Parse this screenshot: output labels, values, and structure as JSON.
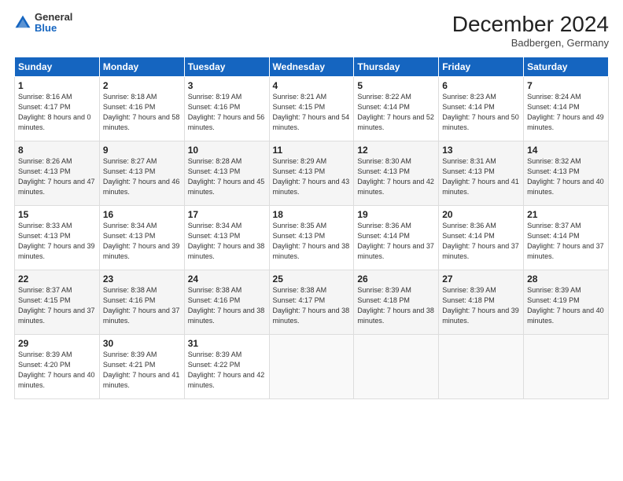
{
  "logo": {
    "general": "General",
    "blue": "Blue"
  },
  "title": "December 2024",
  "location": "Badbergen, Germany",
  "days_header": [
    "Sunday",
    "Monday",
    "Tuesday",
    "Wednesday",
    "Thursday",
    "Friday",
    "Saturday"
  ],
  "weeks": [
    [
      {
        "num": "1",
        "sunrise": "8:16 AM",
        "sunset": "4:17 PM",
        "daylight": "8 hours and 0 minutes."
      },
      {
        "num": "2",
        "sunrise": "8:18 AM",
        "sunset": "4:16 PM",
        "daylight": "7 hours and 58 minutes."
      },
      {
        "num": "3",
        "sunrise": "8:19 AM",
        "sunset": "4:16 PM",
        "daylight": "7 hours and 56 minutes."
      },
      {
        "num": "4",
        "sunrise": "8:21 AM",
        "sunset": "4:15 PM",
        "daylight": "7 hours and 54 minutes."
      },
      {
        "num": "5",
        "sunrise": "8:22 AM",
        "sunset": "4:14 PM",
        "daylight": "7 hours and 52 minutes."
      },
      {
        "num": "6",
        "sunrise": "8:23 AM",
        "sunset": "4:14 PM",
        "daylight": "7 hours and 50 minutes."
      },
      {
        "num": "7",
        "sunrise": "8:24 AM",
        "sunset": "4:14 PM",
        "daylight": "7 hours and 49 minutes."
      }
    ],
    [
      {
        "num": "8",
        "sunrise": "8:26 AM",
        "sunset": "4:13 PM",
        "daylight": "7 hours and 47 minutes."
      },
      {
        "num": "9",
        "sunrise": "8:27 AM",
        "sunset": "4:13 PM",
        "daylight": "7 hours and 46 minutes."
      },
      {
        "num": "10",
        "sunrise": "8:28 AM",
        "sunset": "4:13 PM",
        "daylight": "7 hours and 45 minutes."
      },
      {
        "num": "11",
        "sunrise": "8:29 AM",
        "sunset": "4:13 PM",
        "daylight": "7 hours and 43 minutes."
      },
      {
        "num": "12",
        "sunrise": "8:30 AM",
        "sunset": "4:13 PM",
        "daylight": "7 hours and 42 minutes."
      },
      {
        "num": "13",
        "sunrise": "8:31 AM",
        "sunset": "4:13 PM",
        "daylight": "7 hours and 41 minutes."
      },
      {
        "num": "14",
        "sunrise": "8:32 AM",
        "sunset": "4:13 PM",
        "daylight": "7 hours and 40 minutes."
      }
    ],
    [
      {
        "num": "15",
        "sunrise": "8:33 AM",
        "sunset": "4:13 PM",
        "daylight": "7 hours and 39 minutes."
      },
      {
        "num": "16",
        "sunrise": "8:34 AM",
        "sunset": "4:13 PM",
        "daylight": "7 hours and 39 minutes."
      },
      {
        "num": "17",
        "sunrise": "8:34 AM",
        "sunset": "4:13 PM",
        "daylight": "7 hours and 38 minutes."
      },
      {
        "num": "18",
        "sunrise": "8:35 AM",
        "sunset": "4:13 PM",
        "daylight": "7 hours and 38 minutes."
      },
      {
        "num": "19",
        "sunrise": "8:36 AM",
        "sunset": "4:14 PM",
        "daylight": "7 hours and 37 minutes."
      },
      {
        "num": "20",
        "sunrise": "8:36 AM",
        "sunset": "4:14 PM",
        "daylight": "7 hours and 37 minutes."
      },
      {
        "num": "21",
        "sunrise": "8:37 AM",
        "sunset": "4:14 PM",
        "daylight": "7 hours and 37 minutes."
      }
    ],
    [
      {
        "num": "22",
        "sunrise": "8:37 AM",
        "sunset": "4:15 PM",
        "daylight": "7 hours and 37 minutes."
      },
      {
        "num": "23",
        "sunrise": "8:38 AM",
        "sunset": "4:16 PM",
        "daylight": "7 hours and 37 minutes."
      },
      {
        "num": "24",
        "sunrise": "8:38 AM",
        "sunset": "4:16 PM",
        "daylight": "7 hours and 38 minutes."
      },
      {
        "num": "25",
        "sunrise": "8:38 AM",
        "sunset": "4:17 PM",
        "daylight": "7 hours and 38 minutes."
      },
      {
        "num": "26",
        "sunrise": "8:39 AM",
        "sunset": "4:18 PM",
        "daylight": "7 hours and 38 minutes."
      },
      {
        "num": "27",
        "sunrise": "8:39 AM",
        "sunset": "4:18 PM",
        "daylight": "7 hours and 39 minutes."
      },
      {
        "num": "28",
        "sunrise": "8:39 AM",
        "sunset": "4:19 PM",
        "daylight": "7 hours and 40 minutes."
      }
    ],
    [
      {
        "num": "29",
        "sunrise": "8:39 AM",
        "sunset": "4:20 PM",
        "daylight": "7 hours and 40 minutes."
      },
      {
        "num": "30",
        "sunrise": "8:39 AM",
        "sunset": "4:21 PM",
        "daylight": "7 hours and 41 minutes."
      },
      {
        "num": "31",
        "sunrise": "8:39 AM",
        "sunset": "4:22 PM",
        "daylight": "7 hours and 42 minutes."
      },
      null,
      null,
      null,
      null
    ]
  ]
}
